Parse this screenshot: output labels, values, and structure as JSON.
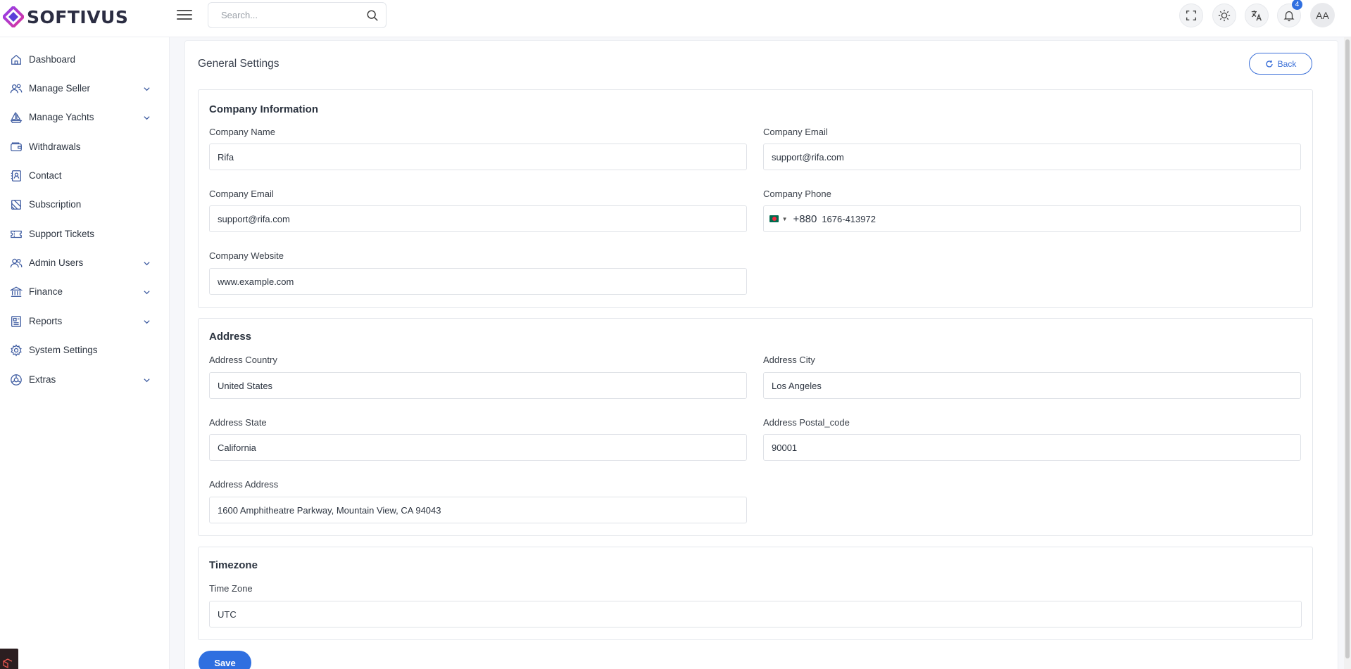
{
  "brand": {
    "name": "SOFTIVUS"
  },
  "header": {
    "search_placeholder": "Search...",
    "notification_count": "4",
    "avatar_initials": "AA"
  },
  "sidebar": {
    "items": [
      {
        "label": "Dashboard",
        "icon": "home-icon",
        "expandable": false
      },
      {
        "label": "Manage Seller",
        "icon": "users-icon",
        "expandable": true
      },
      {
        "label": "Manage Yachts",
        "icon": "sailboat-icon",
        "expandable": true
      },
      {
        "label": "Withdrawals",
        "icon": "wallet-icon",
        "expandable": false
      },
      {
        "label": "Contact",
        "icon": "contact-icon",
        "expandable": false
      },
      {
        "label": "Subscription",
        "icon": "subscription-icon",
        "expandable": false
      },
      {
        "label": "Support Tickets",
        "icon": "ticket-icon",
        "expandable": false
      },
      {
        "label": "Admin Users",
        "icon": "admin-users-icon",
        "expandable": true
      },
      {
        "label": "Finance",
        "icon": "bank-icon",
        "expandable": true
      },
      {
        "label": "Reports",
        "icon": "reports-icon",
        "expandable": true
      },
      {
        "label": "System Settings",
        "icon": "settings-icon",
        "expandable": false
      },
      {
        "label": "Extras",
        "icon": "extras-icon",
        "expandable": true
      }
    ]
  },
  "page": {
    "title": "General Settings",
    "back_label": "Back",
    "save_label": "Save"
  },
  "company": {
    "title": "Company Information",
    "name_label": "Company Name",
    "name_value": "Rifa",
    "email_label": "Company Email",
    "email_value": "support@rifa.com",
    "email2_label": "Company Email",
    "email2_value": "support@rifa.com",
    "phone_label": "Company Phone",
    "phone_dial": "+880",
    "phone_value": "1676-413972",
    "website_label": "Company Website",
    "website_value": "www.example.com"
  },
  "address": {
    "title": "Address",
    "country_label": "Address Country",
    "country_value": "United States",
    "city_label": "Address City",
    "city_value": "Los Angeles",
    "state_label": "Address State",
    "state_value": "California",
    "postal_label": "Address Postal_code",
    "postal_value": "90001",
    "address_label": "Address Address",
    "address_value": "1600 Amphitheatre Parkway, Mountain View, CA 94043"
  },
  "timezone": {
    "title": "Timezone",
    "label": "Time Zone",
    "value": "UTC"
  },
  "colors": {
    "accent": "#2f6fe0",
    "brand_gradient_a": "#8b3df0",
    "brand_gradient_b": "#e0369a"
  }
}
